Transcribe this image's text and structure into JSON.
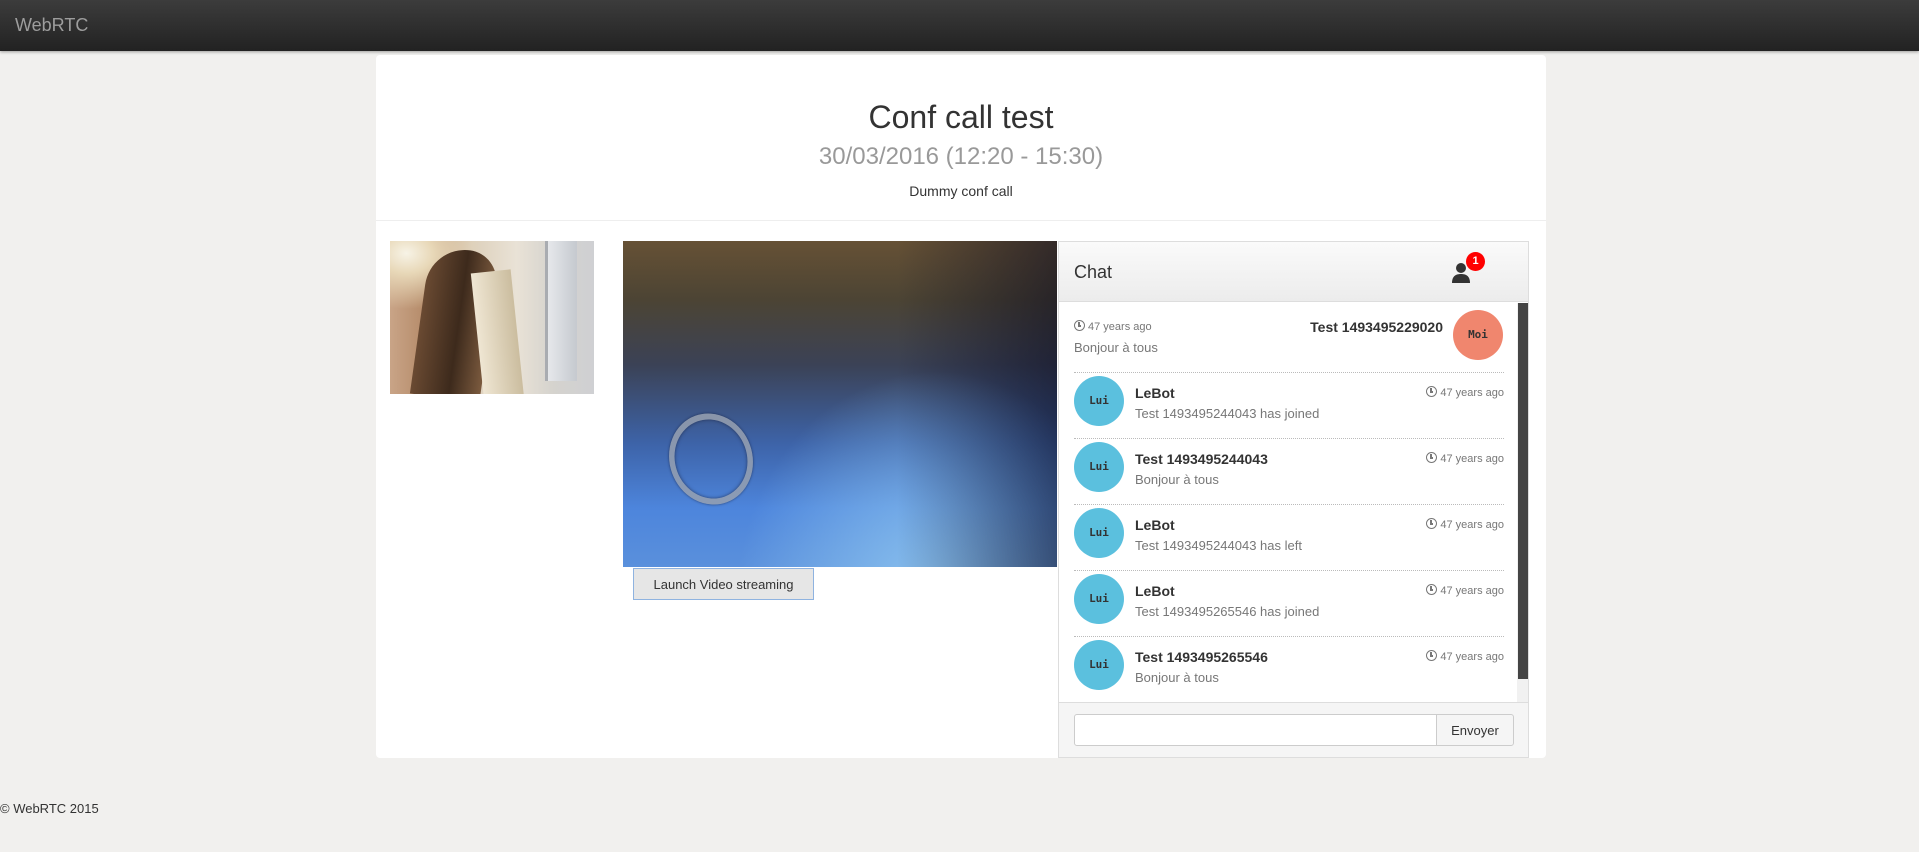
{
  "navbar": {
    "brand": "WebRTC"
  },
  "conference": {
    "title": "Conf call test",
    "date": "30/03/2016 (12:20 - 15:30)",
    "description": "Dummy conf call"
  },
  "video": {
    "launch_button": "Launch Video streaming"
  },
  "chat": {
    "title": "Chat",
    "user_icon": "user-icon",
    "notification_count": "1",
    "messages": [
      {
        "side": "right",
        "avatar": "Moi",
        "name": "Test 1493495229020",
        "time": "47 years ago",
        "text": "Bonjour à tous"
      },
      {
        "side": "left",
        "avatar": "Lui",
        "name": "LeBot",
        "time": "47 years ago",
        "text": "Test 1493495244043 has joined"
      },
      {
        "side": "left",
        "avatar": "Lui",
        "name": "Test 1493495244043",
        "time": "47 years ago",
        "text": "Bonjour à tous"
      },
      {
        "side": "left",
        "avatar": "Lui",
        "name": "LeBot",
        "time": "47 years ago",
        "text": "Test 1493495244043 has left"
      },
      {
        "side": "left",
        "avatar": "Lui",
        "name": "LeBot",
        "time": "47 years ago",
        "text": "Test 1493495265546 has joined"
      },
      {
        "side": "left",
        "avatar": "Lui",
        "name": "Test 1493495265546",
        "time": "47 years ago",
        "text": "Bonjour à tous"
      }
    ],
    "input_value": "",
    "input_placeholder": "",
    "send_button": "Envoyer"
  },
  "colors": {
    "avatar_lui": "#5bc0de",
    "avatar_moi": "#f0866e",
    "badge": "#ff0000",
    "navbar": "#2b2b2b"
  },
  "footer": {
    "text": "© WebRTC 2015"
  }
}
